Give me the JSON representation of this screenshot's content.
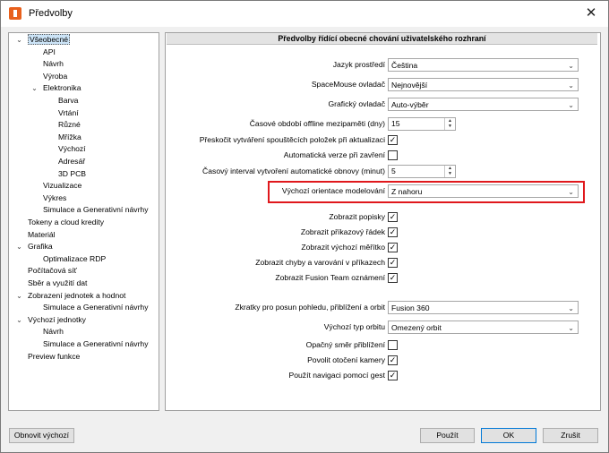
{
  "window": {
    "title": "Předvolby"
  },
  "tree": [
    {
      "label": "Všeobecné",
      "expander": "minus",
      "selected": true
    },
    {
      "label": "API"
    },
    {
      "label": "Návrh"
    },
    {
      "label": "Výroba"
    },
    {
      "label": "Elektronika",
      "expander": "minus"
    },
    {
      "label": "Barva"
    },
    {
      "label": "Vrtání"
    },
    {
      "label": "Různé"
    },
    {
      "label": "Mřížka"
    },
    {
      "label": "Výchozí"
    },
    {
      "label": "Adresář"
    },
    {
      "label": "3D PCB"
    },
    {
      "label": "Vizualizace"
    },
    {
      "label": "Výkres"
    },
    {
      "label": "Simulace a Generativní návrhy"
    },
    {
      "label": "Tokeny a cloud kredity"
    },
    {
      "label": "Materiál"
    },
    {
      "label": "Grafika",
      "expander": "minus"
    },
    {
      "label": "Optimalizace RDP"
    },
    {
      "label": "Počítačová síť"
    },
    {
      "label": "Sběr a využití dat"
    },
    {
      "label": "Zobrazení jednotek a hodnot",
      "expander": "minus"
    },
    {
      "label": "Simulace a Generativní návrhy"
    },
    {
      "label": "Výchozí jednotky",
      "expander": "minus"
    },
    {
      "label": "Návrh"
    },
    {
      "label": "Simulace a Generativní návrhy"
    },
    {
      "label": "Preview funkce"
    }
  ],
  "panel": {
    "title": "Předvolby řídící obecné chování uživatelského rozhraní",
    "language_label": "Jazyk prostředí",
    "language_value": "Čeština",
    "spacemouse_label": "SpaceMouse ovladač",
    "spacemouse_value": "Nejnovější",
    "graphics_label": "Grafický ovladač",
    "graphics_value": "Auto-výběr",
    "offline_label": "Časové období offline mezipaměti (dny)",
    "offline_value": "15",
    "skip_label": "Přeskočit vytváření spouštěcích položek při aktualizaci",
    "autosave_label": "Automatická verze při zavření",
    "autosave_interval_label": "Časový interval vytvoření automatické obnovy (minut)",
    "autosave_interval_value": "5",
    "orientation_label": "Výchozí orientace modelování",
    "orientation_value": "Z nahoru",
    "show_labels": "Zobrazit popisky",
    "show_cmdline": "Zobrazit příkazový řádek",
    "show_scale": "Zobrazit výchozí měřítko",
    "show_errors": "Zobrazit chyby a varování v příkazech",
    "show_team": "Zobrazit Fusion Team oznámení",
    "shortcuts_label": "Zkratky pro posun pohledu, přiblížení a orbit",
    "shortcuts_value": "Fusion 360",
    "orbit_label": "Výchozí typ orbitu",
    "orbit_value": "Omezený orbit",
    "reverse_zoom": "Opačný směr přiblížení",
    "camera_pivot": "Povolit otočení kamery",
    "gestures": "Použít navigaci pomocí gest"
  },
  "buttons": {
    "reset": "Obnovit výchozí",
    "apply": "Použít",
    "ok": "OK",
    "cancel": "Zrušit"
  }
}
